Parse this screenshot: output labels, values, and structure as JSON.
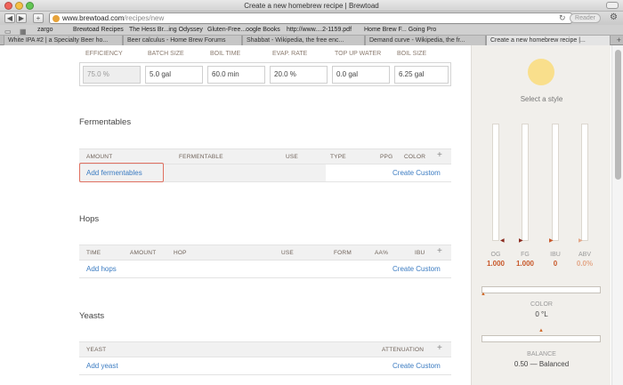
{
  "browser": {
    "window_title": "Create a new homebrew recipe | Brewtoad",
    "url_domain": "www.brewtoad.com",
    "url_path": "/recipes/new",
    "reader_label": "Reader",
    "bookmarks": [
      "zargo",
      "Brewtoad Recipes",
      "The Hess Br...ing Odyssey",
      "Gluten-Free...oogle Books",
      "http://www....2-1159.pdf",
      "Home Brew F... Going Pro"
    ],
    "tabs": [
      {
        "label": "White IPA #2 | a Specialty Beer ho...",
        "active": false
      },
      {
        "label": "Beer calculus - Home Brew Forums",
        "active": false
      },
      {
        "label": "Shabbat - Wikipedia, the free enc...",
        "active": false
      },
      {
        "label": "Demand curve - Wikipedia, the fr...",
        "active": false
      },
      {
        "label": "Create a new homebrew recipe |...",
        "active": true
      }
    ]
  },
  "stats": {
    "headers": [
      "EFFICIENCY",
      "BATCH SIZE",
      "BOIL TIME",
      "EVAP. RATE",
      "TOP UP WATER",
      "BOIL SIZE"
    ],
    "values": [
      "75.0 %",
      "5.0 gal",
      "60.0 min",
      "20.0 %",
      "0.0 gal",
      "6.25 gal"
    ]
  },
  "fermentables": {
    "title": "Fermentables",
    "columns": [
      "AMOUNT",
      "FERMENTABLE",
      "USE",
      "TYPE",
      "PPG",
      "COLOR"
    ],
    "add_label": "Add fermentables",
    "custom_label": "Create Custom"
  },
  "hops": {
    "title": "Hops",
    "columns": [
      "TIME",
      "AMOUNT",
      "HOP",
      "USE",
      "FORM",
      "AA%",
      "IBU"
    ],
    "add_label": "Add hops",
    "custom_label": "Create Custom"
  },
  "yeasts": {
    "title": "Yeasts",
    "columns": [
      "YEAST",
      "ATTENUATION"
    ],
    "add_label": "Add yeast",
    "custom_label": "Create Custom"
  },
  "sidebar": {
    "select_style": "Select a style",
    "style_color": "#f9df8c",
    "gauges": [
      {
        "label": "OG",
        "value": "1.000"
      },
      {
        "label": "FG",
        "value": "1.000"
      },
      {
        "label": "IBU",
        "value": "0"
      },
      {
        "label": "ABV",
        "value": "0.0%"
      }
    ],
    "color_label": "COLOR",
    "color_value": "0 °L",
    "balance_label": "BALANCE",
    "balance_value": "0.50 — Balanced"
  },
  "colors": {
    "link": "#3c7cc2",
    "accent": "#c8582a",
    "highlight": "#e07060"
  }
}
